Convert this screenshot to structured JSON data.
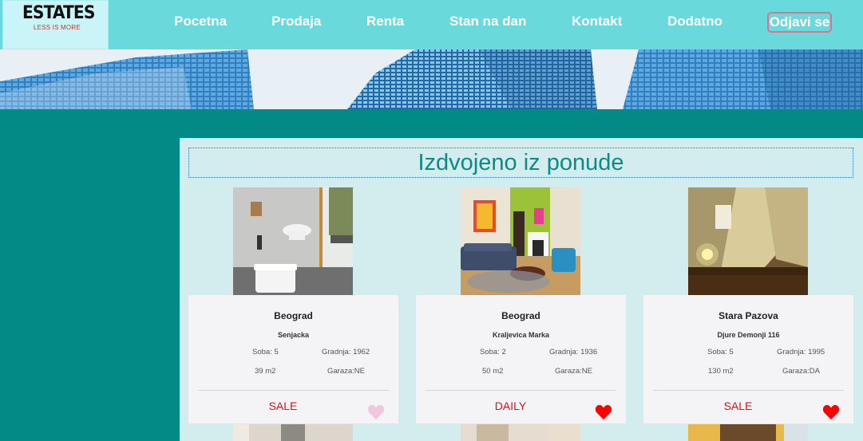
{
  "header": {
    "logo_title": "ESTATES",
    "logo_tagline": "LESS IS MORE",
    "nav": [
      {
        "label": "Pocetna"
      },
      {
        "label": "Prodaja"
      },
      {
        "label": "Renta"
      },
      {
        "label": "Stan na dan"
      },
      {
        "label": "Kontakt"
      },
      {
        "label": "Dodatno"
      }
    ],
    "logout_label": "Odjavi se"
  },
  "main": {
    "section_title": "Izdvojeno iz ponude",
    "listings": [
      {
        "city": "Beograd",
        "street": "Senjacka",
        "rooms": "Soba: 5",
        "built": "Gradnja: 1962",
        "area": "39 m2",
        "garage": "Garaza:NE",
        "type": "SALE",
        "favorite": false
      },
      {
        "city": "Beograd",
        "street": "Kraljevica Marka",
        "rooms": "Soba: 2",
        "built": "Gradnja: 1936",
        "area": "50 m2",
        "garage": "Garaza:NE",
        "type": "DAILY",
        "favorite": true
      },
      {
        "city": "Stara Pazova",
        "street": "Djure Demonji 116",
        "rooms": "Soba: 5",
        "built": "Gradnja: 1995",
        "area": "130 m2",
        "garage": "Garaza:DA",
        "type": "SALE",
        "favorite": true
      }
    ]
  },
  "colors": {
    "header_bg": "#69d9dc",
    "page_bg": "#018a86",
    "panel_bg": "#d3edee",
    "title_color": "#0e8a86",
    "type_color": "#e0101a",
    "heart_active": "#ff0000",
    "heart_inactive": "#f2c6dc"
  },
  "icons": {
    "favorite": "heart-icon"
  }
}
